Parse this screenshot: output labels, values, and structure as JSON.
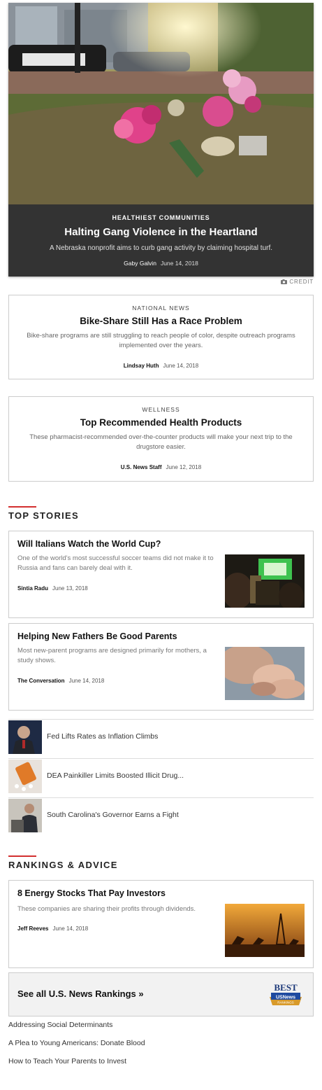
{
  "hero": {
    "kicker": "HEALTHIEST COMMUNITIES",
    "title": "Halting Gang Violence in the Heartland",
    "dek": "A Nebraska nonprofit aims to curb gang activity by claiming hospital turf.",
    "author": "Gaby Galvin",
    "date": "June 14, 2018",
    "image_icon": "memorial-flowers-photo"
  },
  "credit": {
    "label": "CREDIT",
    "icon": "camera-icon"
  },
  "features": [
    {
      "kicker": "NATIONAL NEWS",
      "title": "Bike-Share Still Has a Race Problem",
      "dek": "Bike-share programs are still struggling to reach people of color, despite outreach programs implemented over the years.",
      "author": "Lindsay Huth",
      "date": "June 14, 2018"
    },
    {
      "kicker": "WELLNESS",
      "title": "Top Recommended Health Products",
      "dek": "These pharmacist-recommended over-the-counter products will make your next trip to the drugstore easier.",
      "author": "U.S. News Staff",
      "date": "June 12, 2018"
    }
  ],
  "top_stories": {
    "heading": "TOP STORIES",
    "accent_color": "#d32f2f",
    "cards": [
      {
        "title": "Will Italians Watch the World Cup?",
        "dek": "One of the world's most successful soccer teams did not make it to Russia and fans can barely deal with it.",
        "author": "Sintia Radu",
        "date": "June 13, 2018"
      },
      {
        "title": "Helping New Fathers Be Good Parents",
        "dek": "Most new-parent programs are designed primarily for mothers, a study shows.",
        "author": "The Conversation",
        "date": "June 14, 2018"
      }
    ],
    "list": [
      {
        "text": "Fed Lifts Rates as Inflation Climbs"
      },
      {
        "text": "DEA Painkiller Limits Boosted Illicit Drug..."
      },
      {
        "text": "South Carolina's Governor Earns a Fight"
      }
    ]
  },
  "rankings": {
    "heading": "RANKINGS & ADVICE",
    "card": {
      "title": "8 Energy Stocks That Pay Investors",
      "dek": "These companies are sharing their profits through dividends.",
      "author": "Jeff Reeves",
      "date": "June 14, 2018"
    },
    "see_all": "See all U.S. News Rankings »",
    "badge": {
      "top": "BEST",
      "middle": "USNews",
      "bottom": "RANKINGS"
    }
  },
  "footer_links": [
    "Addressing Social Determinants",
    "A Plea to Young Americans: Donate Blood",
    "How to Teach Your Parents to Invest"
  ]
}
